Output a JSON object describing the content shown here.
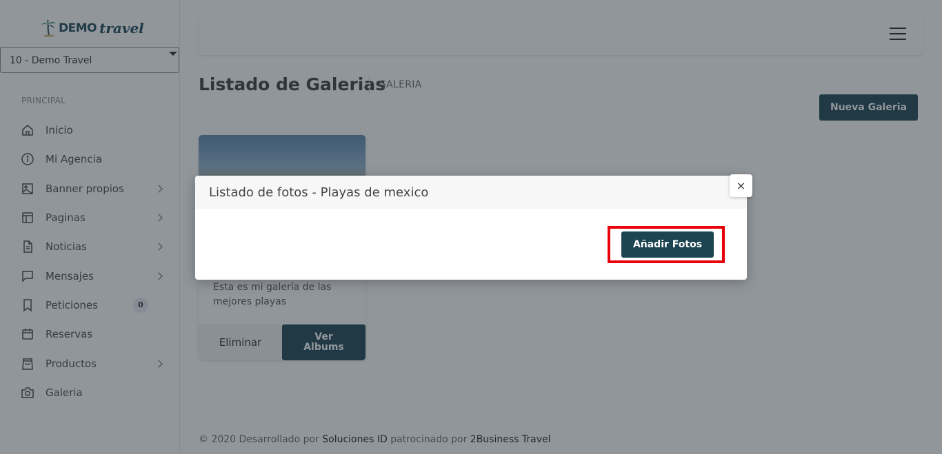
{
  "sidebar": {
    "logo": {
      "brand": "DEMO",
      "tagline": "travel"
    },
    "agency_select": "10 - Demo Travel",
    "section_label": "PRINCIPAL",
    "items": [
      {
        "label": "Inicio",
        "icon": "home-icon"
      },
      {
        "label": "Mi Agencia",
        "icon": "info-icon"
      },
      {
        "label": "Banner propios",
        "icon": "image-icon",
        "has_submenu": true
      },
      {
        "label": "Paginas",
        "icon": "layout-icon",
        "has_submenu": true
      },
      {
        "label": "Noticias",
        "icon": "document-icon",
        "has_submenu": true
      },
      {
        "label": "Mensajes",
        "icon": "message-icon",
        "has_submenu": true
      },
      {
        "label": "Peticiones",
        "icon": "bookmark-icon",
        "badge": "0"
      },
      {
        "label": "Reservas",
        "icon": "calendar-icon"
      },
      {
        "label": "Productos",
        "icon": "shopping-bag-icon",
        "has_submenu": true
      },
      {
        "label": "Galeria",
        "icon": "camera-icon"
      }
    ]
  },
  "header": {
    "menu_icon": "hamburger-icon"
  },
  "page": {
    "title": "Listado de Galerias",
    "breadcrumb": "GALERIA",
    "new_button": "Nueva Galeria"
  },
  "card": {
    "description": "Esta es mi galería de las mejores playas",
    "delete_label": "Eliminar",
    "view_label_line1": "Ver",
    "view_label_line2": "Albums"
  },
  "footer": {
    "prefix": "© 2020 Desarrollado por ",
    "dev": "Soluciones ID",
    "mid": " patrocinado por ",
    "sponsor": "2Business Travel"
  },
  "modal": {
    "title": "Listado de fotos - Playas de mexico",
    "close": "×",
    "add_button": "Añadir Fotos"
  },
  "colors": {
    "primary": "#1d4451",
    "highlight": "#e8000b",
    "overlay": "rgba(35,45,55,0.5)"
  }
}
